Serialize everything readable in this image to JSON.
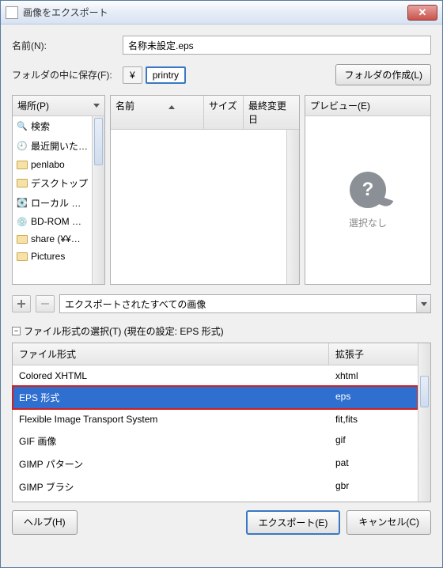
{
  "window": {
    "title": "画像をエクスポート"
  },
  "name": {
    "label": "名前(N):",
    "value": "名称未設定.eps"
  },
  "save_in": {
    "label": "フォルダの中に保存(F):",
    "seg1": "¥",
    "seg2": "printry",
    "create_folder": "フォルダの作成(L)"
  },
  "places": {
    "header": "場所(P)",
    "items": [
      {
        "icon": "search",
        "label": "検索"
      },
      {
        "icon": "recent",
        "label": "最近開いた…"
      },
      {
        "icon": "folder",
        "label": "penlabo"
      },
      {
        "icon": "folder",
        "label": "デスクトップ"
      },
      {
        "icon": "drive",
        "label": "ローカル …"
      },
      {
        "icon": "disc",
        "label": "BD-ROM …"
      },
      {
        "icon": "folder",
        "label": "share (¥¥…"
      },
      {
        "icon": "folder",
        "label": "Pictures"
      }
    ]
  },
  "files": {
    "col_name": "名前",
    "col_size": "サイズ",
    "col_date": "最終変更日"
  },
  "preview": {
    "header": "プレビュー(E)",
    "empty": "選択なし"
  },
  "filter": {
    "value": "エクスポートされたすべての画像"
  },
  "filetype": {
    "header": "ファイル形式の選択(T) (現在の設定: EPS 形式)",
    "col_type": "ファイル形式",
    "col_ext": "拡張子",
    "rows": [
      {
        "type": "Colored XHTML",
        "ext": "xhtml",
        "sel": false
      },
      {
        "type": "EPS 形式",
        "ext": "eps",
        "sel": true
      },
      {
        "type": "Flexible Image Transport System",
        "ext": "fit,fits",
        "sel": false
      },
      {
        "type": "GIF 画像",
        "ext": "gif",
        "sel": false
      },
      {
        "type": "GIMP パターン",
        "ext": "pat",
        "sel": false
      },
      {
        "type": "GIMP ブラシ",
        "ext": "gbr",
        "sel": false
      }
    ]
  },
  "buttons": {
    "help": "ヘルプ(H)",
    "export": "エクスポート(E)",
    "cancel": "キャンセル(C)"
  }
}
